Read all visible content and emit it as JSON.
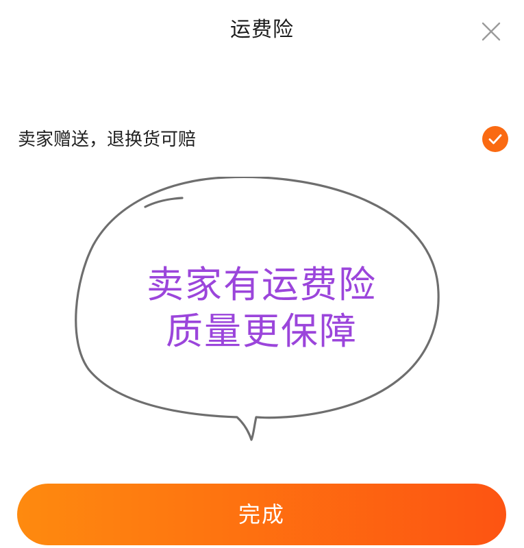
{
  "header": {
    "title": "运费险",
    "close_icon": "close-icon"
  },
  "option": {
    "label": "卖家赠送，退换货可赔",
    "checked": true,
    "check_icon": "checkmark-icon"
  },
  "promo_bubble": {
    "line1": "卖家有运费险",
    "line2": "质量更保障"
  },
  "footer": {
    "done_label": "完成"
  },
  "colors": {
    "accent": "#fa6a12",
    "promo_text": "#9b45db",
    "button_gradient_start": "#fe8a0f",
    "button_gradient_end": "#fd5412",
    "bubble_stroke": "#6e6e6e"
  }
}
